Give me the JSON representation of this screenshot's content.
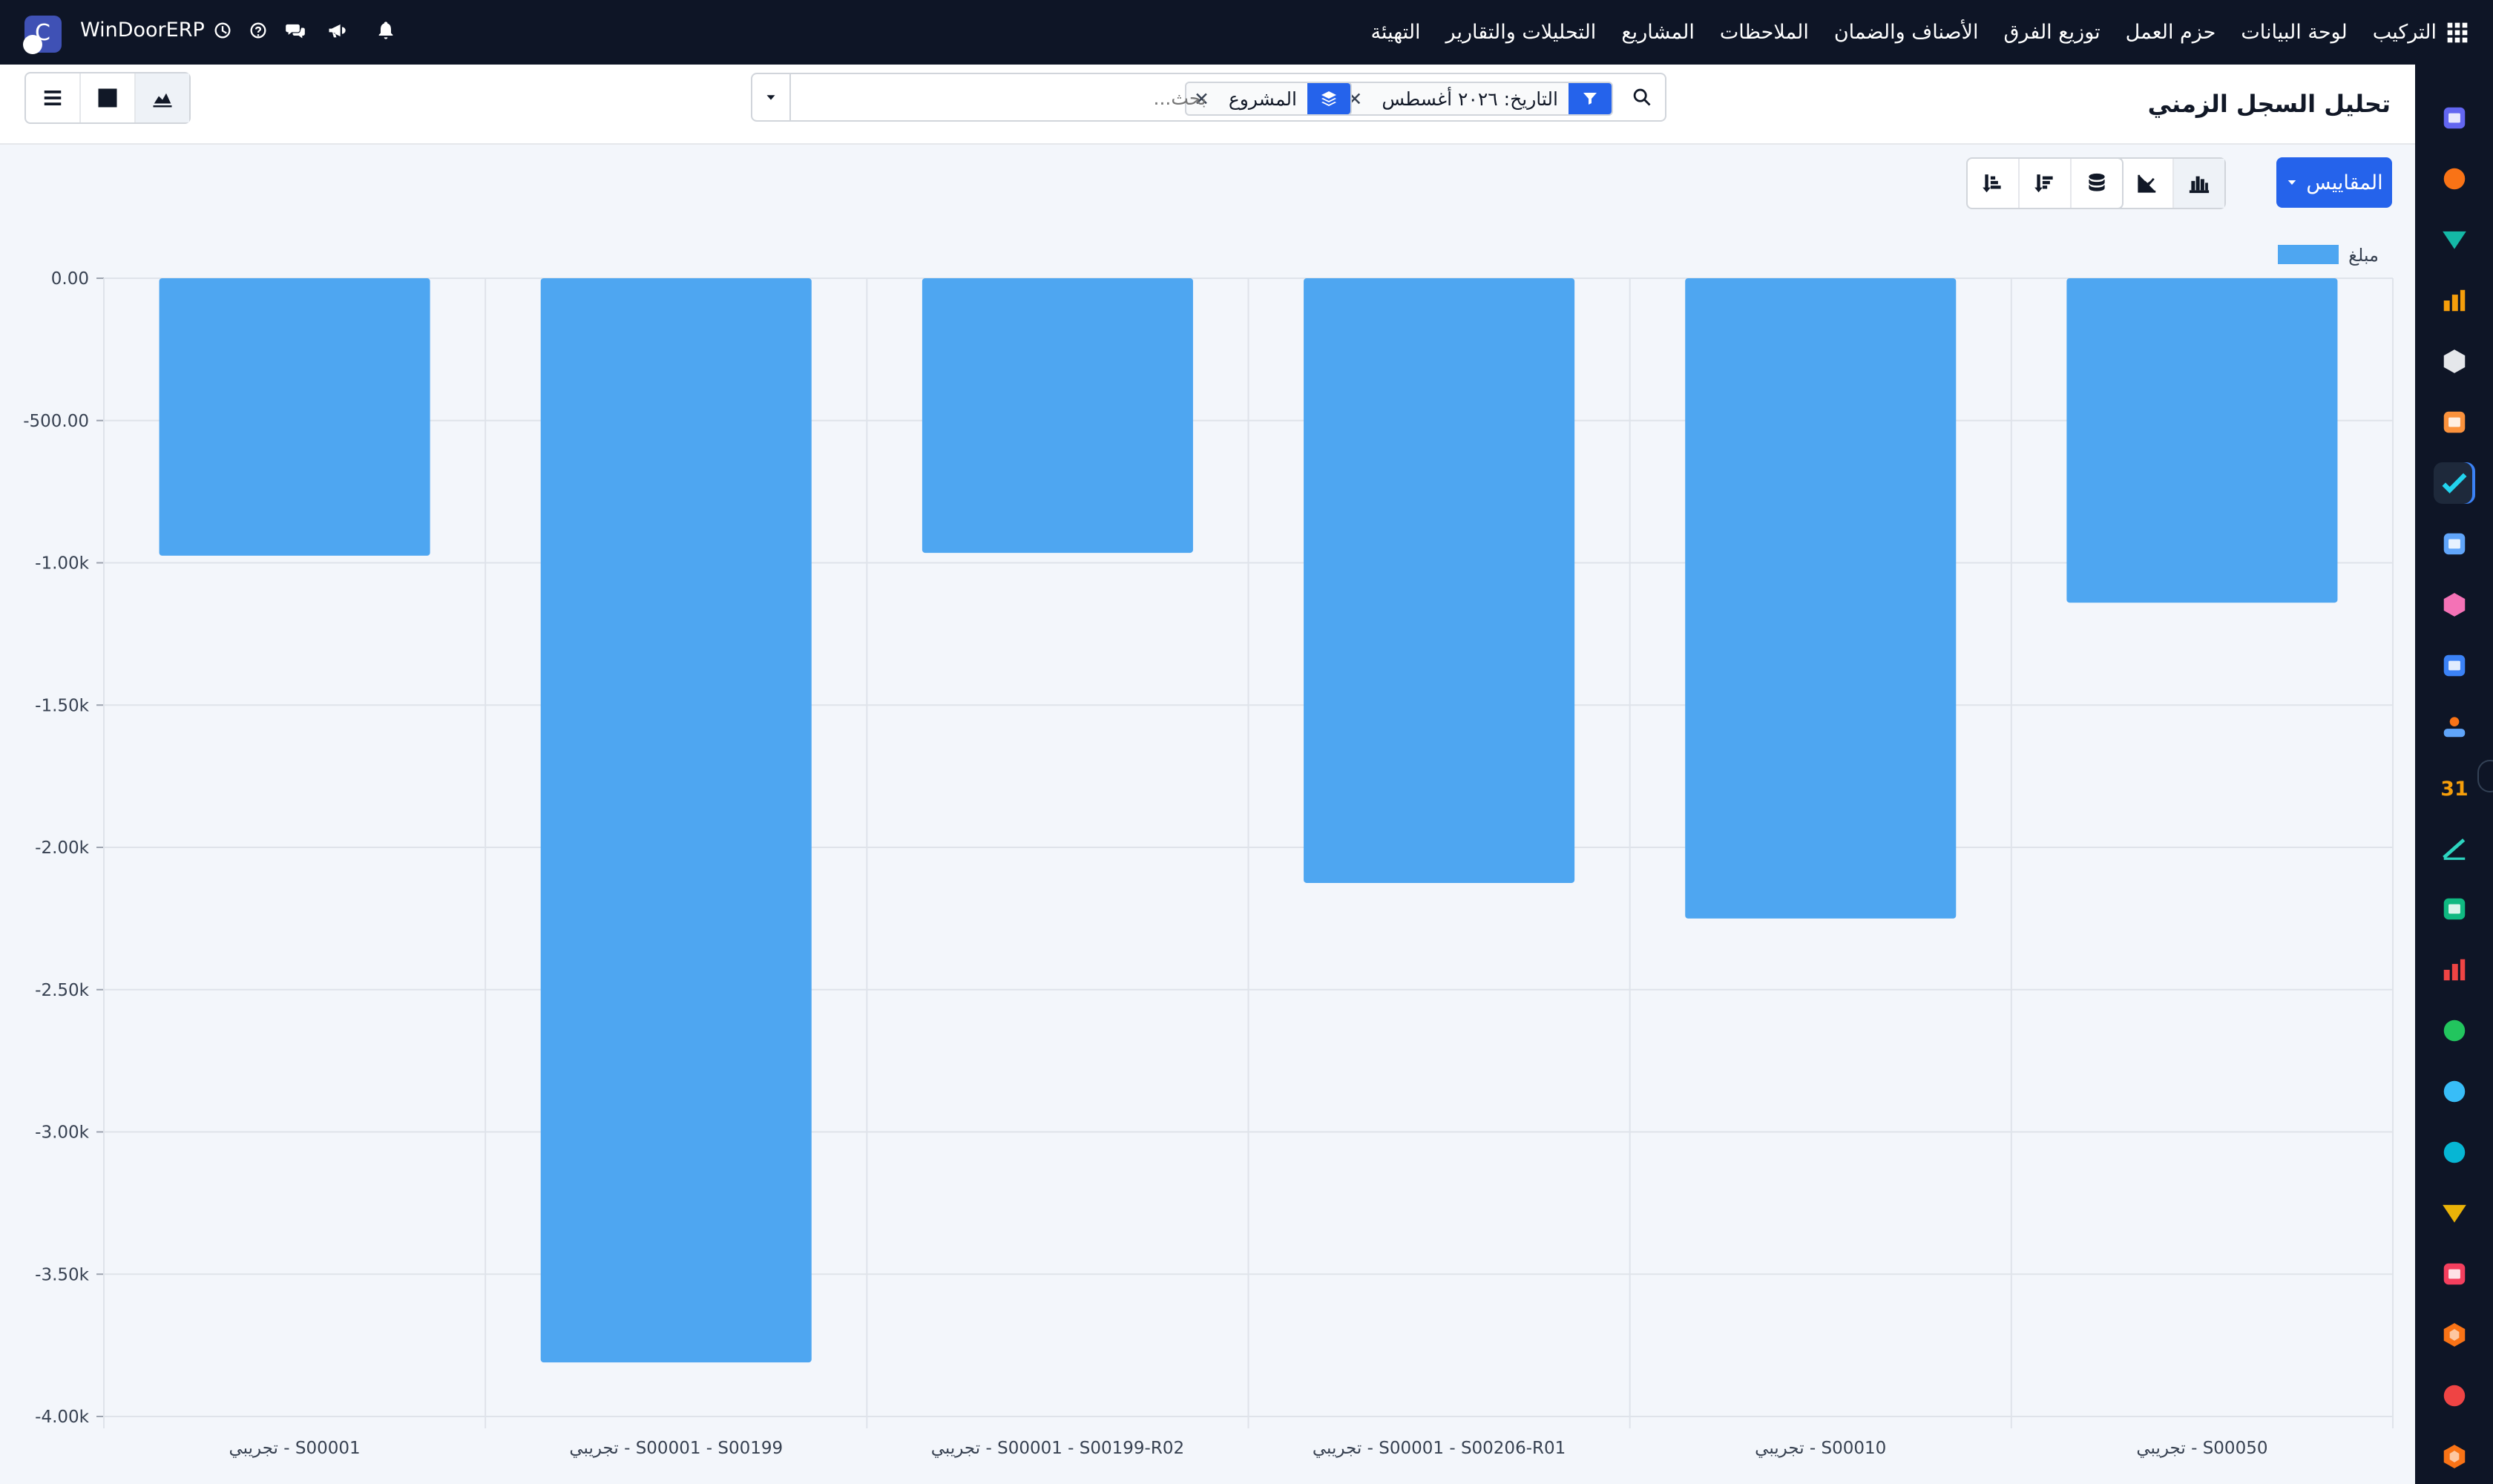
{
  "navbar": {
    "brand": "WinDoorERP",
    "menu": [
      "التركيب",
      "لوحة البيانات",
      "حزم العمل",
      "توزيع الفرق",
      "الأصناف والضمان",
      "الملاحظات",
      "المشاريع",
      "التحليلات والتقارير",
      "التهيئة"
    ]
  },
  "control": {
    "title": "تحليل السجل الزمني",
    "search_placeholder": "بحث...",
    "facets": [
      {
        "icon": "filter-icon",
        "label": "التاريخ: ٢٠٢٦ أغسطس"
      },
      {
        "icon": "layers-icon",
        "label": "المشروع"
      }
    ]
  },
  "toolbar": {
    "measures_label": "المقاييس"
  },
  "colors": {
    "bar": "#4ea6f1",
    "primary": "#2563eb",
    "navbar": "#0e1526"
  },
  "chart_data": {
    "type": "bar",
    "categories": [
      "S00050 - تجريبي",
      "S00010 - تجريبي",
      "S00001 - S00206-R01 - تجريبي",
      "S00001 - S00199-R02 - تجريبي",
      "S00001 - S00199 - تجريبي",
      "S00001 - تجريبي"
    ],
    "series": [
      {
        "name": "مبلغ",
        "values": [
          -1140,
          -2250,
          -2125,
          -965,
          -3810,
          -975
        ]
      }
    ],
    "ylim": [
      -4000,
      0
    ],
    "yticks": [
      "0.00",
      "-500.00",
      "-1.00k",
      "-1.50k",
      "-2.00k",
      "-2.50k",
      "-3.00k",
      "-3.50k",
      "-4.00k"
    ],
    "grid": true,
    "legend": "top-right",
    "direction": "rtl"
  }
}
